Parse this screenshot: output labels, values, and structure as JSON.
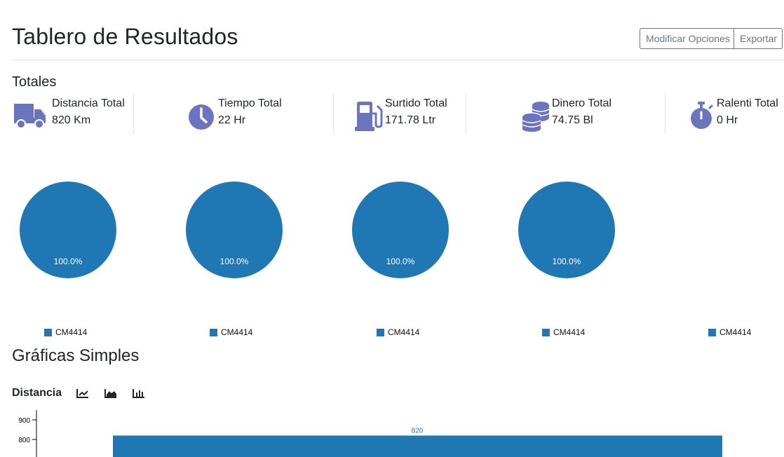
{
  "header": {
    "title": "Tablero de Resultados",
    "modify_label": "Modificar Opciones",
    "export_label": "Exportar"
  },
  "totals": {
    "heading": "Totales",
    "icon_color": "#6b74bf",
    "items": [
      {
        "label": "Distancia Total",
        "value": "820 Km",
        "icon": "truck-icon"
      },
      {
        "label": "Tiempo Total",
        "value": "22 Hr",
        "icon": "clock-icon"
      },
      {
        "label": "Surtido Total",
        "value": "171.78 Ltr",
        "icon": "gas-pump-icon"
      },
      {
        "label": "Dinero Total",
        "value": "74.75 Bl",
        "icon": "coins-icon"
      },
      {
        "label": "Ralenti Total",
        "value": "0 Hr",
        "icon": "stopwatch-icon"
      }
    ]
  },
  "pies": [
    {
      "percent_label": "100.0%",
      "legend": "CM4414"
    },
    {
      "percent_label": "100.0%",
      "legend": "CM4414"
    },
    {
      "percent_label": "100.0%",
      "legend": "CM4414"
    },
    {
      "percent_label": "100.0%",
      "legend": "CM4414"
    },
    {
      "legend": "CM4414"
    }
  ],
  "simple_charts": {
    "heading": "Gráficas Simples",
    "distance_title": "Distancia",
    "icons": [
      "line-chart-icon",
      "area-chart-icon",
      "bar-chart-icon"
    ]
  },
  "chart_data": [
    {
      "type": "pie",
      "categories": [
        "CM4414"
      ],
      "values": [
        100
      ],
      "labels": [
        "100.0%"
      ],
      "color": "#1f77b4"
    },
    {
      "type": "pie",
      "categories": [
        "CM4414"
      ],
      "values": [
        100
      ],
      "labels": [
        "100.0%"
      ],
      "color": "#1f77b4"
    },
    {
      "type": "pie",
      "categories": [
        "CM4414"
      ],
      "values": [
        100
      ],
      "labels": [
        "100.0%"
      ],
      "color": "#1f77b4"
    },
    {
      "type": "pie",
      "categories": [
        "CM4414"
      ],
      "values": [
        100
      ],
      "labels": [
        "100.0%"
      ],
      "color": "#1f77b4"
    },
    {
      "type": "bar",
      "title": "Distancia",
      "categories": [
        "CM4414"
      ],
      "values": [
        820
      ],
      "data_labels": [
        "820"
      ],
      "yticks": [
        800,
        900
      ],
      "color": "#1f77b4"
    }
  ]
}
